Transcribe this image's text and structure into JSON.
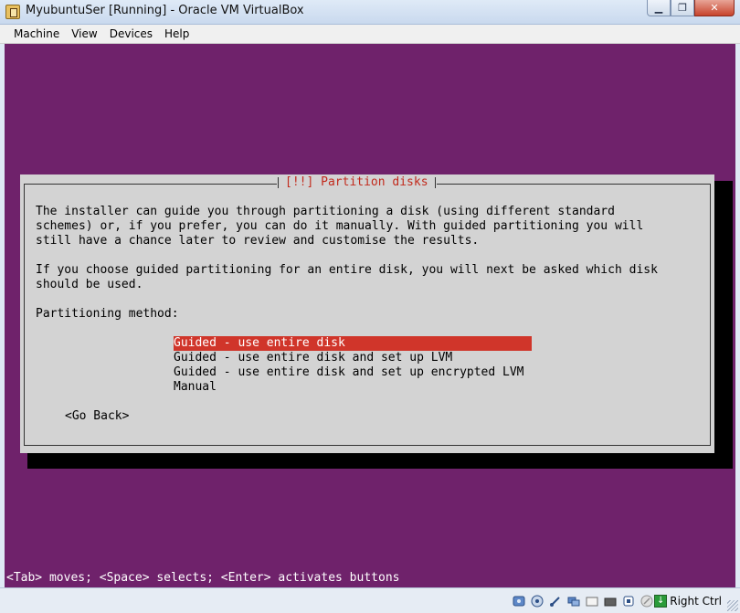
{
  "window": {
    "title": "MyubuntuSer [Running] - Oracle VM VirtualBox",
    "minimize_icon": "minimize-icon",
    "restore_icon": "restore-icon",
    "close_icon": "close-icon"
  },
  "menu": {
    "items": [
      "Machine",
      "View",
      "Devices",
      "Help"
    ]
  },
  "installer": {
    "dialog_title": "[!!] Partition disks",
    "paragraph1": [
      "The installer can guide you through partitioning a disk (using different standard",
      "schemes) or, if you prefer, you can do it manually. With guided partitioning you will",
      "still have a chance later to review and customise the results."
    ],
    "paragraph2": [
      "If you choose guided partitioning for an entire disk, you will next be asked which disk",
      "should be used."
    ],
    "method_label": "Partitioning method:",
    "options": [
      "Guided - use entire disk",
      "Guided - use entire disk and set up LVM",
      "Guided - use entire disk and set up encrypted LVM",
      "Manual"
    ],
    "selected_index": 0,
    "go_back": "<Go Back>",
    "help_line": "<Tab> moves; <Space> selects; <Enter> activates buttons",
    "colors": {
      "background": "#6f226b",
      "dialog": "#d3d3d3",
      "highlight": "#d0352a",
      "title": "#c22a1c"
    }
  },
  "statusbar": {
    "icons": [
      "hard-disk-icon",
      "optical-drive-icon",
      "usb-icon",
      "network-icon",
      "shared-folders-icon",
      "display-icon",
      "video-capture-icon",
      "mouse-integration-icon"
    ],
    "host_key": "Right Ctrl"
  }
}
